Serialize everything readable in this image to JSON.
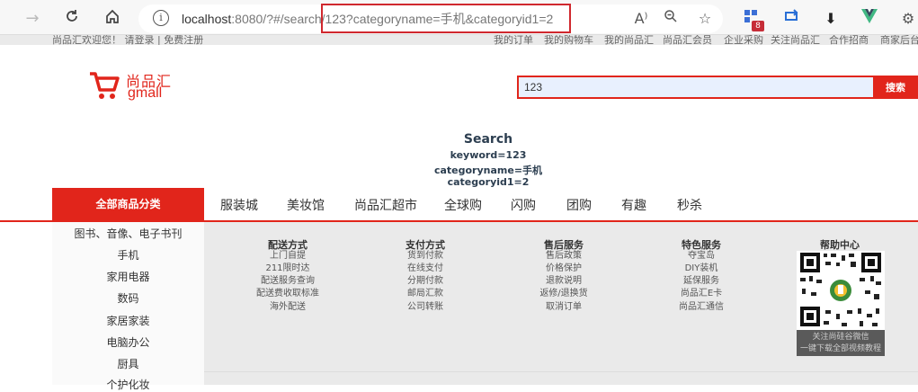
{
  "browser": {
    "url_host": "localhost",
    "url_rest": ":8080/?#/search/123?categoryname=手机&categoryid1=2",
    "extension_badge": "8"
  },
  "shortcut": {
    "left": "尚品汇欢迎您！  请登录 | 免费注册",
    "right": [
      "我的订单",
      "我的购物车",
      "我的尚品汇",
      "尚品汇会员",
      "企业采购",
      "关注尚品汇",
      "合作招商",
      "商家后台"
    ]
  },
  "header": {
    "logo_cn": "尚品汇",
    "logo_en": "gmall",
    "search_value": "123",
    "search_button": "搜索"
  },
  "search_info": {
    "title": "Search",
    "keyword": "keyword=123",
    "categoryname": "categoryname=手机",
    "categoryid": "categoryid1=2"
  },
  "nav": {
    "all_categories": "全部商品分类",
    "items": [
      "服装城",
      "美妆馆",
      "尚品汇超市",
      "全球购",
      "闪购",
      "团购",
      "有趣",
      "秒杀"
    ]
  },
  "categories": [
    "图书、音像、电子书刊",
    "手机",
    "家用电器",
    "数码",
    "家居家装",
    "电脑办公",
    "厨具",
    "个护化妆"
  ],
  "footer": {
    "columns": [
      {
        "title": "配送方式",
        "items": [
          "上门自提",
          "211限时达",
          "配送服务查询",
          "配送费收取标准",
          "海外配送"
        ]
      },
      {
        "title": "支付方式",
        "items": [
          "货到付款",
          "在线支付",
          "分期付款",
          "邮局汇款",
          "公司转账"
        ]
      },
      {
        "title": "售后服务",
        "items": [
          "售后政策",
          "价格保护",
          "退款说明",
          "返修/退换货",
          "取消订单"
        ]
      },
      {
        "title": "特色服务",
        "items": [
          "夺宝岛",
          "DIY装机",
          "延保服务",
          "尚品汇E卡",
          "尚品汇通信"
        ]
      }
    ],
    "help_title": "帮助中心",
    "qr_caption_1": "关注尚硅谷微信",
    "qr_caption_2": "一键下载全部视频教程"
  },
  "colors": {
    "brand_red": "#e1251b"
  }
}
